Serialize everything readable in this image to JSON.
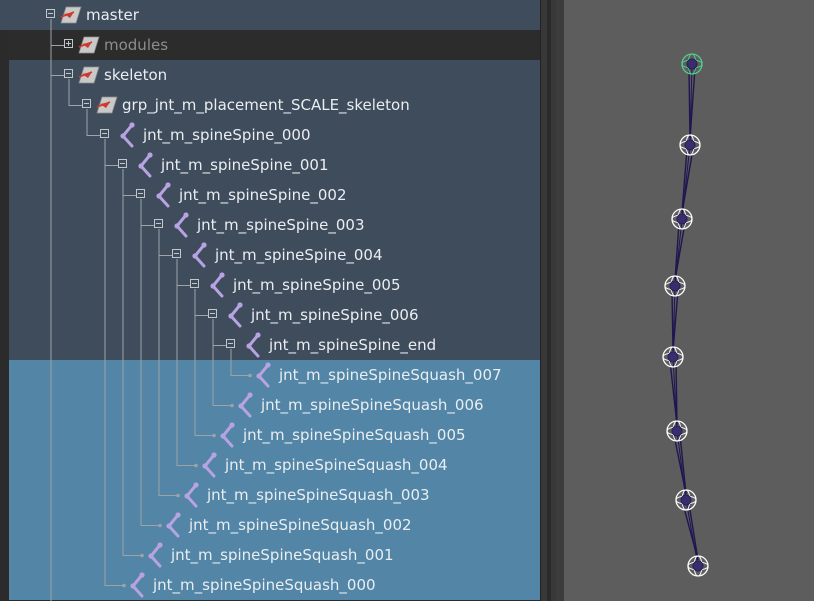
{
  "outliner": {
    "items": [
      {
        "label": "master",
        "depth": 0,
        "icon": "transform-icon",
        "expander": "expanded",
        "dim": false,
        "selected": false
      },
      {
        "label": "modules",
        "depth": 1,
        "icon": "transform-icon",
        "expander": "collapsed",
        "dim": true,
        "selected": false
      },
      {
        "label": "skeleton",
        "depth": 1,
        "icon": "transform-icon",
        "expander": "expanded",
        "dim": false,
        "selected": false
      },
      {
        "label": "grp_jnt_m_placement_SCALE_skeleton",
        "depth": 2,
        "icon": "transform-icon",
        "expander": "expanded",
        "dim": false,
        "selected": false
      },
      {
        "label": "jnt_m_spineSpine_000",
        "depth": 3,
        "icon": "joint-icon",
        "expander": "expanded",
        "dim": false,
        "selected": false
      },
      {
        "label": "jnt_m_spineSpine_001",
        "depth": 4,
        "icon": "joint-icon",
        "expander": "expanded",
        "dim": false,
        "selected": false
      },
      {
        "label": "jnt_m_spineSpine_002",
        "depth": 5,
        "icon": "joint-icon",
        "expander": "expanded",
        "dim": false,
        "selected": false
      },
      {
        "label": "jnt_m_spineSpine_003",
        "depth": 6,
        "icon": "joint-icon",
        "expander": "expanded",
        "dim": false,
        "selected": false
      },
      {
        "label": "jnt_m_spineSpine_004",
        "depth": 7,
        "icon": "joint-icon",
        "expander": "expanded",
        "dim": false,
        "selected": false
      },
      {
        "label": "jnt_m_spineSpine_005",
        "depth": 8,
        "icon": "joint-icon",
        "expander": "expanded",
        "dim": false,
        "selected": false
      },
      {
        "label": "jnt_m_spineSpine_006",
        "depth": 9,
        "icon": "joint-icon",
        "expander": "expanded",
        "dim": false,
        "selected": false
      },
      {
        "label": "jnt_m_spineSpine_end",
        "depth": 10,
        "icon": "joint-icon",
        "expander": "expanded",
        "dim": false,
        "selected": false
      },
      {
        "label": "jnt_m_spineSpineSquash_007",
        "depth": 11,
        "icon": "joint-icon",
        "expander": "none",
        "dim": false,
        "selected": true
      },
      {
        "label": "jnt_m_spineSpineSquash_006",
        "depth": 10,
        "icon": "joint-icon",
        "expander": "none",
        "dim": false,
        "selected": true
      },
      {
        "label": "jnt_m_spineSpineSquash_005",
        "depth": 9,
        "icon": "joint-icon",
        "expander": "none",
        "dim": false,
        "selected": true
      },
      {
        "label": "jnt_m_spineSpineSquash_004",
        "depth": 8,
        "icon": "joint-icon",
        "expander": "none",
        "dim": false,
        "selected": true
      },
      {
        "label": "jnt_m_spineSpineSquash_003",
        "depth": 7,
        "icon": "joint-icon",
        "expander": "none",
        "dim": false,
        "selected": true
      },
      {
        "label": "jnt_m_spineSpineSquash_002",
        "depth": 6,
        "icon": "joint-icon",
        "expander": "none",
        "dim": false,
        "selected": true
      },
      {
        "label": "jnt_m_spineSpineSquash_001",
        "depth": 5,
        "icon": "joint-icon",
        "expander": "none",
        "dim": false,
        "selected": true
      },
      {
        "label": "jnt_m_spineSpineSquash_000",
        "depth": 4,
        "icon": "joint-icon",
        "expander": "none",
        "dim": false,
        "selected": true
      }
    ]
  },
  "colors": {
    "row_normal": "#3f4c5b",
    "row_dim": "#2c2c2c",
    "row_selected": "#5285a6",
    "transform_icon_fill": "#c9c9c9",
    "transform_icon_accent": "#d03a2c",
    "joint_icon": "#b8a3e2",
    "joint_locator_selected": "#4fd08f",
    "joint_locator": "#ffffff",
    "bone": "#1f1650"
  },
  "viewport": {
    "joint_count": 8
  }
}
